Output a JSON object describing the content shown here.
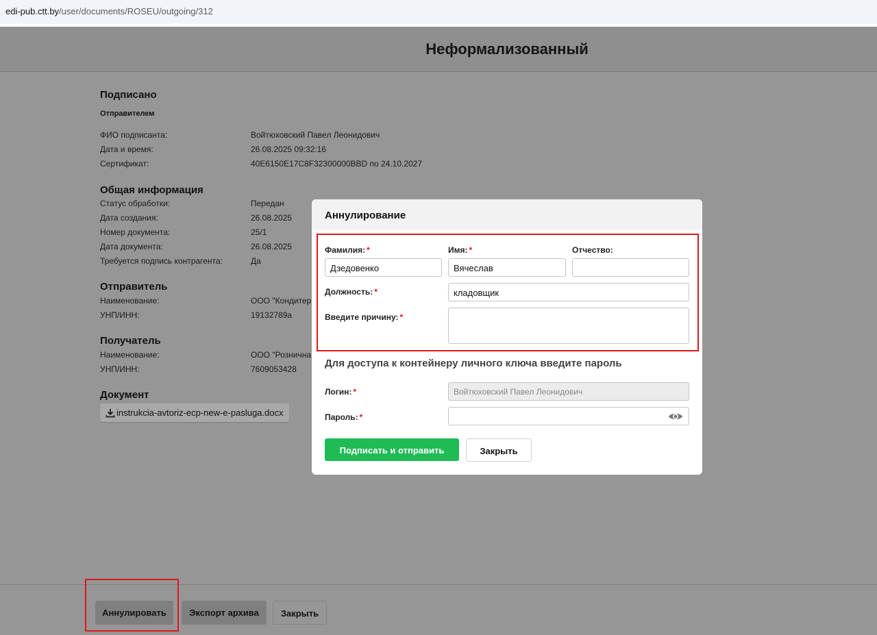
{
  "browser": {
    "url_host": "edi-pub.ctt.by",
    "url_path": "/user/documents/ROSEU/outgoing/312"
  },
  "header": {
    "title": "Неформализованный"
  },
  "signed": {
    "title": "Подписано",
    "subtitle": "Отправителем",
    "rows": [
      {
        "label": "ФИО подписанта:",
        "value": "Войтюховский Павел Леонидович"
      },
      {
        "label": "Дата и время:",
        "value": "26.08.2025 09:32:16"
      },
      {
        "label": "Сертификат:",
        "value": "40E6150E17C8F32300000BBD по 24.10.2027"
      }
    ]
  },
  "general": {
    "title": "Общая информация",
    "rows": [
      {
        "label": "Статус обработки:",
        "value": "Передан"
      },
      {
        "label": "Дата создания:",
        "value": "26.08.2025"
      },
      {
        "label": "Номер документа:",
        "value": "25/1"
      },
      {
        "label": "Дата документа:",
        "value": "26.08.2025"
      },
      {
        "label": "Требуется подпись контрагента:",
        "value": "Да"
      }
    ]
  },
  "sender": {
    "title": "Отправитель",
    "rows": [
      {
        "label": "Наименование:",
        "value": "ООО \"Кондитер"
      },
      {
        "label": "УНП/ИНН:",
        "value": "19132789а"
      }
    ]
  },
  "receiver": {
    "title": "Получатель",
    "rows": [
      {
        "label": "Наименование:",
        "value": "ООО \"Рознична"
      },
      {
        "label": "УНП/ИНН:",
        "value": "7609053428"
      }
    ]
  },
  "document": {
    "title": "Документ",
    "file": "instrukcia-avtoriz-ecp-new-e-pasluga.docx"
  },
  "footer": {
    "annul": "Аннулировать",
    "export": "Экспорт архива",
    "close": "Закрыть"
  },
  "modal": {
    "title": "Аннулирование",
    "surname": {
      "label": "Фамилия:",
      "value": "Дзедовенко"
    },
    "name": {
      "label": "Имя:",
      "value": "Вячеслав"
    },
    "patronymic": {
      "label": "Отчество:",
      "value": ""
    },
    "position": {
      "label": "Должность:",
      "value": "кладовщик"
    },
    "reason": {
      "label": "Введите причину:",
      "value": ""
    },
    "password_title": "Для доступа к контейнеру личного ключа введите пароль",
    "login": {
      "label": "Логин:",
      "value": "Войтюховский Павел Леонидович"
    },
    "password": {
      "label": "Пароль:",
      "value": ""
    },
    "submit": "Подписать и отправить",
    "close": "Закрыть",
    "required_mark": "*"
  },
  "colors": {
    "accent_green": "#1fbb55",
    "highlight_red": "#e0161b",
    "overlay_grey": "#969696"
  },
  "icons": {
    "download": "download-icon",
    "eye": "eye-icon"
  }
}
